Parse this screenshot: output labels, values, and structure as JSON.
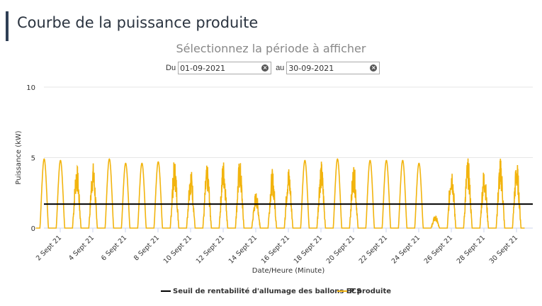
{
  "header": {
    "title": "Courbe de la puissance produite"
  },
  "period": {
    "heading": "Sélectionnez la période à afficher",
    "from_label": "Du",
    "from_value": "01-09-2021",
    "to_label": "au",
    "to_value": "30-09-2021",
    "clear_icon": "clear-icon"
  },
  "colors": {
    "production": "#f2b40e",
    "threshold": "#000000",
    "grid": "#e6e6e6"
  },
  "chart_data": {
    "type": "line",
    "xlabel": "Date/Heure (Minute)",
    "ylabel": "Puissance (kW)",
    "ylim": [
      0,
      10
    ],
    "yticks": [
      0,
      5,
      10
    ],
    "xticks": [
      "2 Sept 21",
      "4 Sept 21",
      "6 Sept 21",
      "8 Sept 21",
      "10 Sept 21",
      "12 Sept 21",
      "14 Sept 21",
      "16 Sept 21",
      "18 Sept 21",
      "20 Sept 21",
      "22 Sept 21",
      "24 Sept 21",
      "26 Sept 21",
      "28 Sept 21",
      "30 Sept 21"
    ],
    "xtick_days": [
      2,
      4,
      6,
      8,
      10,
      12,
      14,
      16,
      18,
      20,
      22,
      24,
      26,
      28,
      30
    ],
    "xlim_days": [
      1,
      31
    ],
    "grid": "horizontal",
    "legend": "bottom-center",
    "series": [
      {
        "name": "Seuil de rentabilité d'allumage des ballons ECS",
        "kind": "constant",
        "value": 1.7
      },
      {
        "name": "P produite",
        "kind": "daily",
        "days": [
          1,
          2,
          3,
          4,
          5,
          6,
          7,
          8,
          9,
          10,
          11,
          12,
          13,
          14,
          15,
          16,
          17,
          18,
          19,
          20,
          21,
          22,
          23,
          24,
          25,
          26,
          27,
          28,
          29,
          30
        ],
        "daily_peak_kw": [
          4.9,
          4.8,
          4.6,
          4.7,
          4.9,
          4.6,
          4.6,
          4.7,
          4.9,
          4.3,
          4.5,
          4.9,
          4.9,
          2.6,
          4.2,
          4.4,
          4.8,
          4.8,
          4.9,
          4.6,
          4.8,
          4.8,
          4.8,
          4.6,
          0.9,
          4.6,
          5.0,
          4.3,
          5.0,
          4.8
        ],
        "daily_cloudy": [
          0,
          0,
          1,
          1,
          0,
          0,
          0,
          0,
          1,
          1,
          1,
          1,
          1,
          1,
          1,
          1,
          0,
          1,
          0,
          1,
          0,
          0,
          0,
          0,
          1,
          1,
          1,
          1,
          1,
          1
        ]
      }
    ]
  }
}
